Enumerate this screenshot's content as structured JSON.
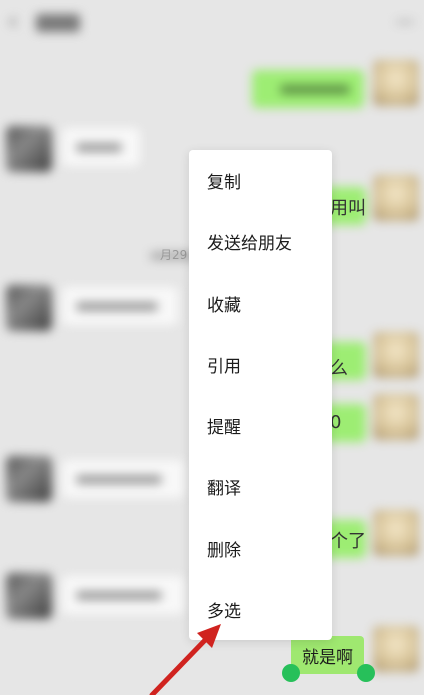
{
  "context_menu": {
    "items": [
      {
        "label": "复制",
        "name": "menu-item-copy"
      },
      {
        "label": "发送给朋友",
        "name": "menu-item-send-to-friend"
      },
      {
        "label": "收藏",
        "name": "menu-item-favorite"
      },
      {
        "label": "引用",
        "name": "menu-item-quote"
      },
      {
        "label": "提醒",
        "name": "menu-item-remind"
      },
      {
        "label": "翻译",
        "name": "menu-item-translate"
      },
      {
        "label": "删除",
        "name": "menu-item-delete"
      },
      {
        "label": "多选",
        "name": "menu-item-multi-select"
      }
    ]
  },
  "selected_message": {
    "text": "就是啊"
  },
  "partial_texts": {
    "date": "月29",
    "reply_a": "用叫",
    "reply_b": "么",
    "reply_c": "0",
    "reply_d": "个了"
  },
  "colors": {
    "outgoing_bubble": "#9fe870",
    "selection_handle": "#27c05a",
    "annotation_arrow": "#d0231f",
    "menu_background": "#ffffff"
  },
  "icons": {
    "back": "back-chevron-icon",
    "more": "more-options-icon",
    "annotation": "red-arrow-annotation"
  }
}
